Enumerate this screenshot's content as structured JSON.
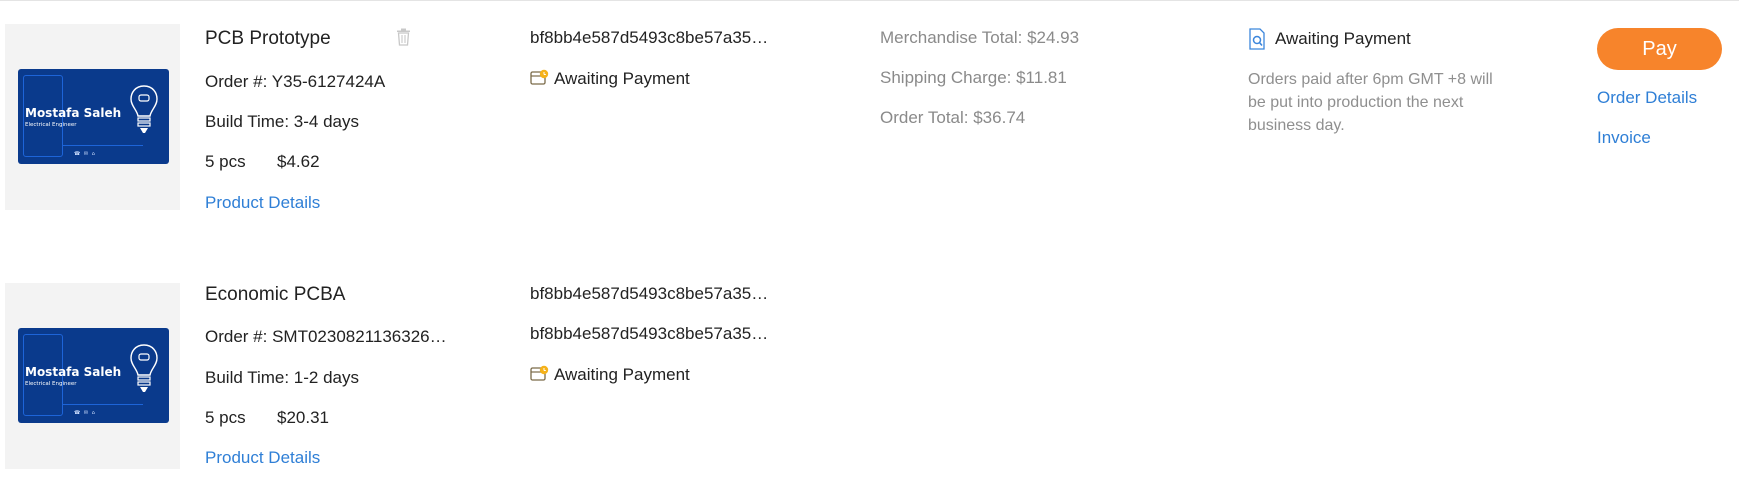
{
  "orders": [
    {
      "product_title": "PCB Prototype",
      "order_no": "Order #: Y35-6127424A",
      "build_time": "Build Time: 3-4 days",
      "qty": "5 pcs",
      "price": "$4.62",
      "product_details_link": "Product Details",
      "thumbnail": {
        "card_name": "Mostafa Saleh",
        "card_subtitle": "Electrical Engineer"
      },
      "hashes": [
        "bf8bb4e587d5493c8be57a35…"
      ],
      "file_status": "Awaiting Payment",
      "totals": {
        "merchandise": "Merchandise Total: $24.93",
        "shipping": "Shipping Charge: $11.81",
        "order_total": "Order Total: $36.74"
      },
      "order_status": "Awaiting Payment",
      "status_note": "Orders paid after 6pm GMT +8 will be put into production the next business day.",
      "actions": {
        "pay": "Pay",
        "order_details": "Order Details",
        "invoice": "Invoice"
      }
    },
    {
      "product_title": "Economic PCBA",
      "order_no": "Order #: SMT0230821136326…",
      "build_time": "Build Time: 1-2 days",
      "qty": "5 pcs",
      "price": "$20.31",
      "product_details_link": "Product Details",
      "thumbnail": {
        "card_name": "Mostafa Saleh",
        "card_subtitle": "Electrical Engineer"
      },
      "hashes": [
        "bf8bb4e587d5493c8be57a35…",
        "bf8bb4e587d5493c8be57a35…"
      ],
      "file_status": "Awaiting Payment"
    }
  ],
  "icons": {
    "delete": "trash-icon",
    "file_status": "payment-pending-icon",
    "order_status": "document-search-icon"
  },
  "colors": {
    "accent_orange": "#f7842b",
    "link_blue": "#2f7fd6",
    "card_navy": "#0a3a8c",
    "muted_text": "#8a8a8a"
  }
}
